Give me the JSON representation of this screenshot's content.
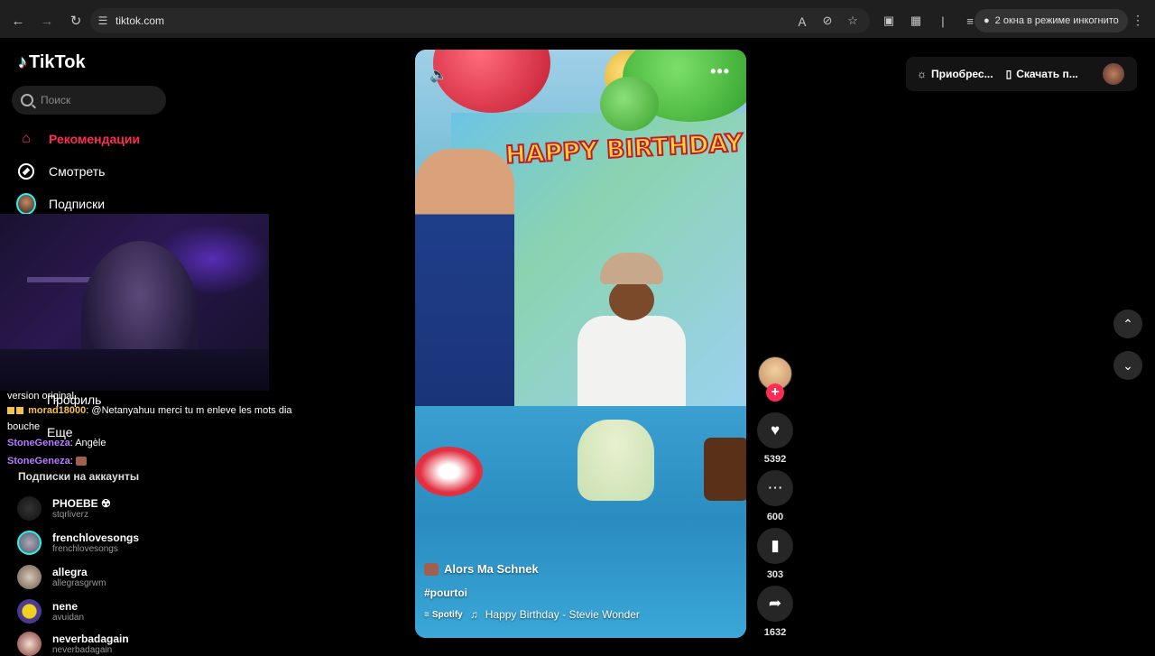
{
  "browser": {
    "url": "tiktok.com",
    "incognito_label": "2 окна в режиме инкогнито"
  },
  "sidebar": {
    "logo": "TikTok",
    "search_placeholder": "Поиск",
    "nav": [
      {
        "label": "Рекомендации",
        "icon": "home-icon",
        "active": true
      },
      {
        "label": "Смотреть",
        "icon": "compass-icon",
        "active": false
      },
      {
        "label": "Подписки",
        "icon": "following-avatar-icon",
        "active": false
      }
    ],
    "hidden_nav": {
      "profile": "Профиль",
      "more": "Еще"
    },
    "following_title": "Подписки на аккаунты",
    "following": [
      {
        "name": "PHOEBE ☢",
        "handle": "stqrliverz"
      },
      {
        "name": "frenchlovesongs",
        "handle": "frenchlovesongs"
      },
      {
        "name": "allegra",
        "handle": "allegrasgrwm"
      },
      {
        "name": "nene",
        "handle": "avuidan"
      },
      {
        "name": "neverbadagain",
        "handle": "neverbadagain"
      }
    ]
  },
  "stream_chat": [
    {
      "user": "",
      "text": "version original"
    },
    {
      "user": "morad18000",
      "text": "@Netanyahuu merci tu m enleve les mots dia bouche",
      "color": "#f3c24c"
    },
    {
      "user": "StoneGeneza",
      "text": "Angèle",
      "color": "#b67bff"
    },
    {
      "user": "StoneGeneza",
      "text": "",
      "color": "#b67bff"
    }
  ],
  "video": {
    "author": "Alors Ma Schnek",
    "hashtag": "#pourtoi",
    "music_source": "Spotify",
    "music": "Happy Birthday - Stevie Wonder",
    "banner_text": "HAPPY BIRTHDAY"
  },
  "actions": {
    "likes": "5392",
    "comments": "600",
    "saves": "303",
    "shares": "1632"
  },
  "header": {
    "buy_coins": "Приобрес...",
    "download": "Скачать п..."
  },
  "colors": {
    "accent": "#fe2c55",
    "background": "#000000"
  }
}
